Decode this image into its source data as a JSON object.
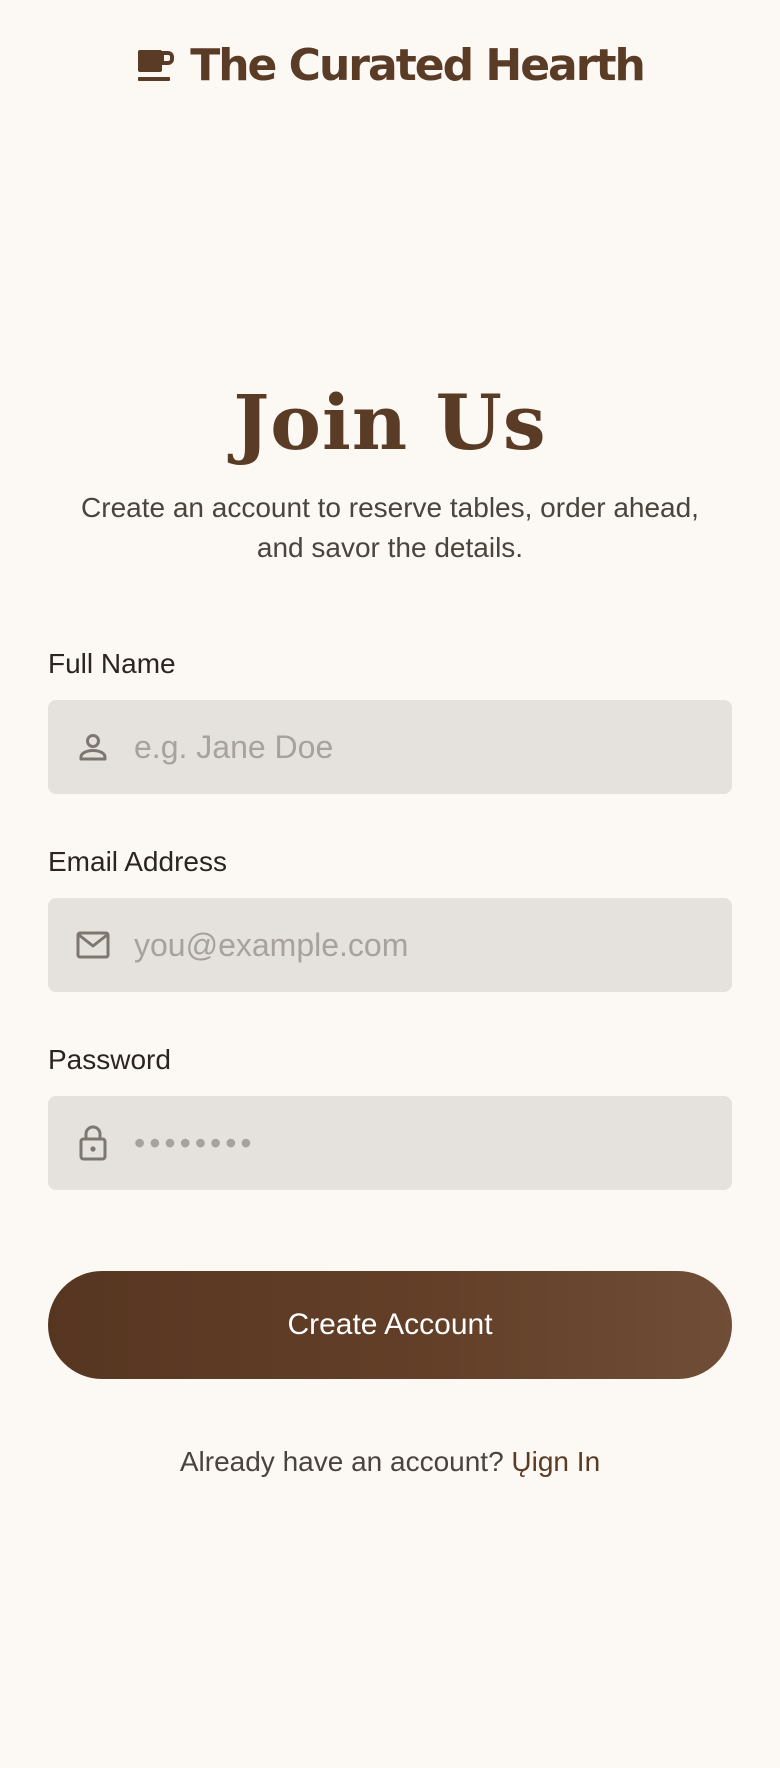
{
  "brand": {
    "name": "The Curated Hearth",
    "icon": "coffee-cup-icon",
    "color": "#5a3b26"
  },
  "hero": {
    "title": "Join Us",
    "subtitle": "Create an account to reserve tables, order ahead, and savor the details."
  },
  "form": {
    "full_name": {
      "label": "Full Name",
      "placeholder": "e.g. Jane Doe",
      "icon": "person-icon"
    },
    "email": {
      "label": "Email Address",
      "placeholder": "you@example.com",
      "icon": "mail-icon"
    },
    "password": {
      "label": "Password",
      "placeholder": "••••••••",
      "icon": "lock-icon"
    },
    "submit_label": "Create Account"
  },
  "footer": {
    "prompt": "Already have an account?",
    "link_label": "Ųign In"
  },
  "colors": {
    "background": "#fcf8f3",
    "field_background": "#e5e1dc",
    "button_gradient_start": "#573621",
    "button_gradient_end": "#6f4d36",
    "button_text": "#ffffff"
  }
}
